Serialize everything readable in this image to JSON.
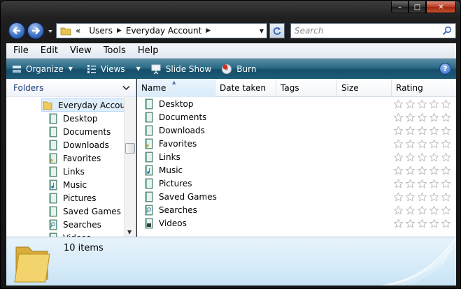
{
  "window": {
    "buttons": {
      "minimize": "–",
      "maximize": "□",
      "close": "✕"
    }
  },
  "address": {
    "overflow": "«",
    "crumbs": [
      "Users",
      "Everyday Account"
    ]
  },
  "search": {
    "placeholder": "Search"
  },
  "menu": [
    "File",
    "Edit",
    "View",
    "Tools",
    "Help"
  ],
  "commands": {
    "organize": "Organize",
    "views": "Views",
    "slideshow": "Slide Show",
    "burn": "Burn",
    "help": "?"
  },
  "navpane": {
    "header": "Folders",
    "root": "Everyday Account",
    "items": [
      {
        "label": "Desktop",
        "icon": "desktop-folder-icon"
      },
      {
        "label": "Documents",
        "icon": "documents-folder-icon"
      },
      {
        "label": "Downloads",
        "icon": "downloads-folder-icon"
      },
      {
        "label": "Favorites",
        "icon": "favorites-folder-icon"
      },
      {
        "label": "Links",
        "icon": "links-folder-icon"
      },
      {
        "label": "Music",
        "icon": "music-folder-icon"
      },
      {
        "label": "Pictures",
        "icon": "pictures-folder-icon"
      },
      {
        "label": "Saved Games",
        "icon": "saved-games-folder-icon"
      },
      {
        "label": "Searches",
        "icon": "searches-folder-icon"
      },
      {
        "label": "Videos",
        "icon": "videos-folder-icon"
      }
    ]
  },
  "columns": {
    "name": "Name",
    "date": "Date taken",
    "tags": "Tags",
    "size": "Size",
    "rating": "Rating"
  },
  "files": [
    {
      "name": "Desktop",
      "rating": 0
    },
    {
      "name": "Documents",
      "rating": 0
    },
    {
      "name": "Downloads",
      "rating": 0
    },
    {
      "name": "Favorites",
      "rating": 0
    },
    {
      "name": "Links",
      "rating": 0
    },
    {
      "name": "Music",
      "rating": 0
    },
    {
      "name": "Pictures",
      "rating": 0
    },
    {
      "name": "Saved Games",
      "rating": 0
    },
    {
      "name": "Searches",
      "rating": 0
    },
    {
      "name": "Videos",
      "rating": 0
    }
  ],
  "details": {
    "count": "10 items"
  },
  "colors": {
    "command_bar": "#1c5b78",
    "folder_yellow": "#f3d36b",
    "link_blue": "#1c3c78"
  }
}
